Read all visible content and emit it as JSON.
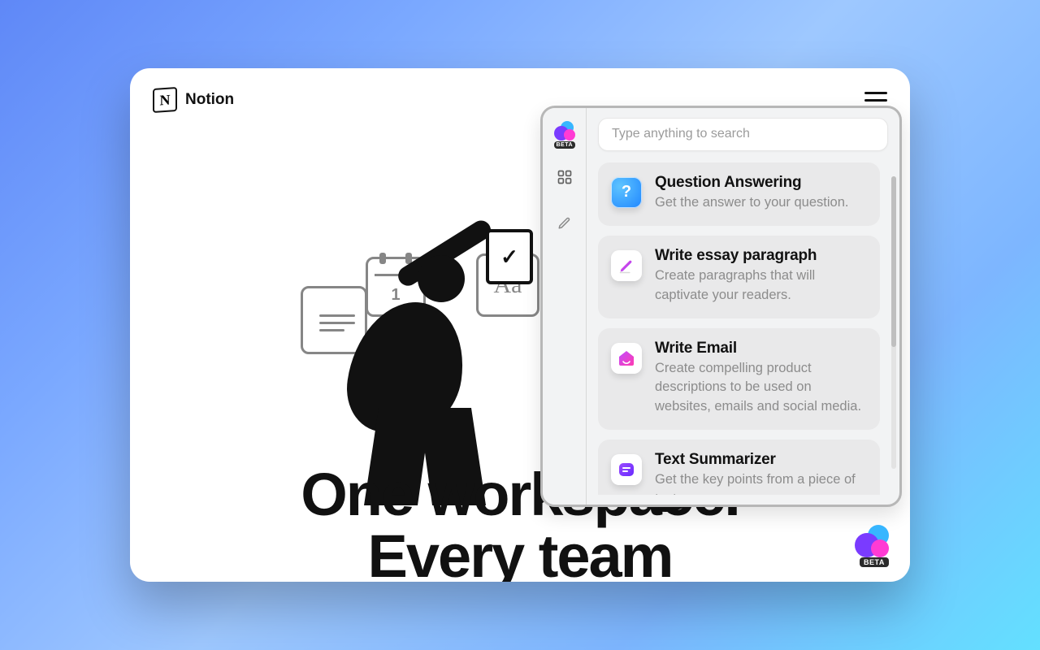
{
  "brand": {
    "name": "Notion",
    "logo_letter": "N"
  },
  "hero": {
    "line1": "One workspace.",
    "line2": "Every team"
  },
  "illustration": {
    "card_aa": "Aa",
    "paper_check": "✓",
    "calendar_day": "1"
  },
  "ai_panel": {
    "badge": "BETA",
    "search": {
      "placeholder": "Type anything to search",
      "value": ""
    },
    "rail": {
      "grid_icon": "grid-icon",
      "pencil_icon": "pencil-icon"
    },
    "items": [
      {
        "title": "Question Answering",
        "desc": "Get the answer to your question.",
        "icon": "question"
      },
      {
        "title": "Write essay paragraph",
        "desc": "Create paragraphs that will captivate your readers.",
        "icon": "pencil"
      },
      {
        "title": "Write Email",
        "desc": "Create compelling product descriptions to be used on websites, emails and social media.",
        "icon": "house"
      },
      {
        "title": "Text Summarizer",
        "desc": "Get the key points from a piece of text.",
        "icon": "summary"
      }
    ]
  },
  "float_badge": "BETA"
}
